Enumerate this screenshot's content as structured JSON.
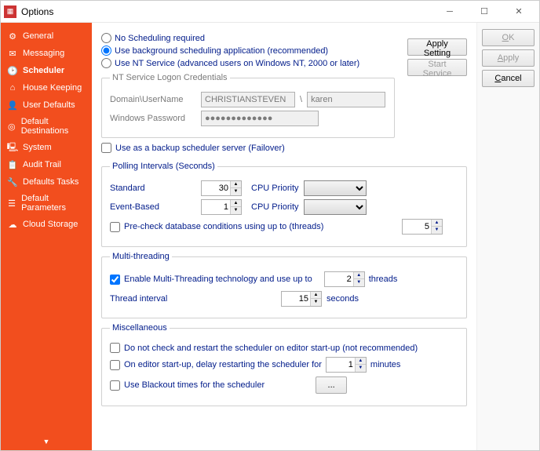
{
  "window": {
    "title": "Options"
  },
  "sidebar": {
    "items": [
      {
        "label": "General"
      },
      {
        "label": "Messaging"
      },
      {
        "label": "Scheduler"
      },
      {
        "label": "House Keeping"
      },
      {
        "label": "User Defaults"
      },
      {
        "label": "Default Destinations"
      },
      {
        "label": "System"
      },
      {
        "label": "Audit Trail"
      },
      {
        "label": "Defaults Tasks"
      },
      {
        "label": "Default Parameters"
      },
      {
        "label": "Cloud Storage"
      }
    ]
  },
  "scheduling": {
    "none": "No Scheduling required",
    "background": "Use background scheduling application (recommended)",
    "ntservice": "Use NT Service (advanced users on Windows NT, 2000 or later)"
  },
  "ntcreds": {
    "legend": "NT Service Logon Credentials",
    "domain_lbl": "Domain\\UserName",
    "domain": "CHRISTIANSTEVEN",
    "slash": "\\",
    "user": "karen",
    "pass_lbl": "Windows Password",
    "pass": "●●●●●●●●●●●●●"
  },
  "failover": "Use as a backup scheduler server (Failover)",
  "polling": {
    "legend": "Polling Intervals (Seconds)",
    "standard_lbl": "Standard",
    "standard_val": "30",
    "event_lbl": "Event-Based",
    "event_val": "1",
    "cpu_lbl": "CPU Priority",
    "precheck": "Pre-check database conditions using up to (threads)",
    "precheck_val": "5"
  },
  "multithread": {
    "legend": "Multi-threading",
    "enable": "Enable Multi-Threading technology and use up to",
    "threads_val": "2",
    "threads_unit": "threads",
    "interval_lbl": "Thread interval",
    "interval_val": "15",
    "interval_unit": "seconds"
  },
  "misc": {
    "legend": "Miscellaneous",
    "nocheck": "Do not check and restart the scheduler on editor start-up (not recommended)",
    "delay": "On editor start-up, delay restarting the scheduler for",
    "delay_val": "1",
    "delay_unit": "minutes",
    "blackout": "Use Blackout times for the scheduler",
    "blackout_btn": "..."
  },
  "buttons": {
    "apply_setting": "Apply Setting",
    "start_service": "Start Service",
    "ok": "OK",
    "apply": "Apply",
    "cancel": "Cancel"
  }
}
